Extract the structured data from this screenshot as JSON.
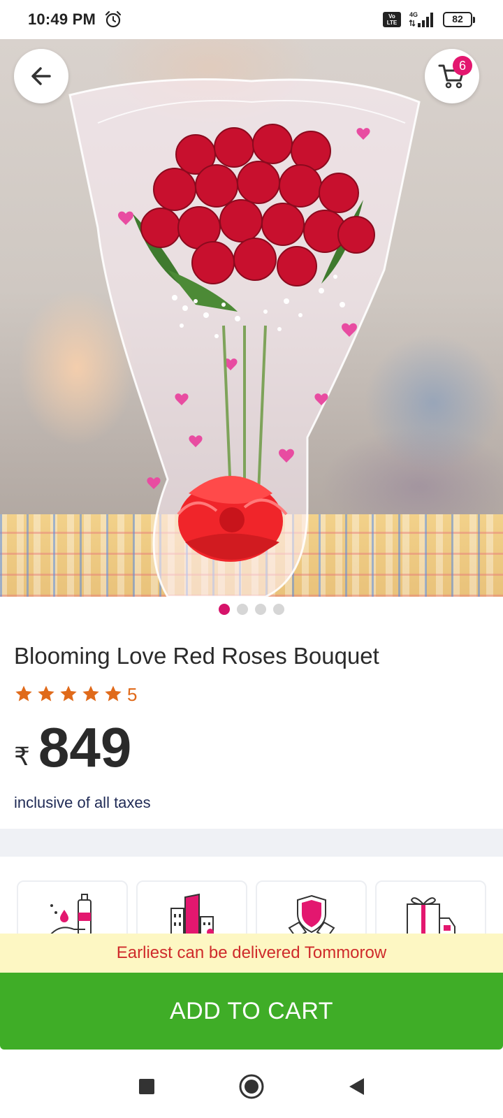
{
  "status_bar": {
    "time": "10:49 PM",
    "network": "4G",
    "volte": "Vo LTE",
    "battery": "82",
    "icons": [
      "alarm-icon",
      "volte-icon",
      "signal-icon",
      "battery-icon"
    ]
  },
  "header": {
    "back_icon": "arrow-left-icon",
    "cart_icon": "cart-icon",
    "cart_count": "6"
  },
  "carousel": {
    "total": 4,
    "active_index": 0,
    "image": "red-roses-bouquet"
  },
  "product": {
    "title": "Blooming Love Red Roses Bouquet",
    "rating": 5,
    "rating_label": "5",
    "currency": "₹",
    "price": "849",
    "tax_note": "inclusive of all taxes"
  },
  "features": [
    {
      "icon": "sanitized-hands-icon"
    },
    {
      "icon": "city-buildings-icon"
    },
    {
      "icon": "secure-shield-icon"
    },
    {
      "icon": "gift-delivery-icon"
    }
  ],
  "delivery": {
    "text": "Earliest can be delivered Tommorow"
  },
  "cta": {
    "add_to_cart": "ADD TO CART"
  },
  "colors": {
    "accent": "#d6136a",
    "cta": "#3fad27",
    "rating": "#e06a1a",
    "delivery_text": "#cf2b2b",
    "delivery_bg": "#fdf7c3"
  },
  "nav": {
    "icons": [
      "recents-square-icon",
      "home-circle-icon",
      "back-triangle-icon"
    ]
  }
}
